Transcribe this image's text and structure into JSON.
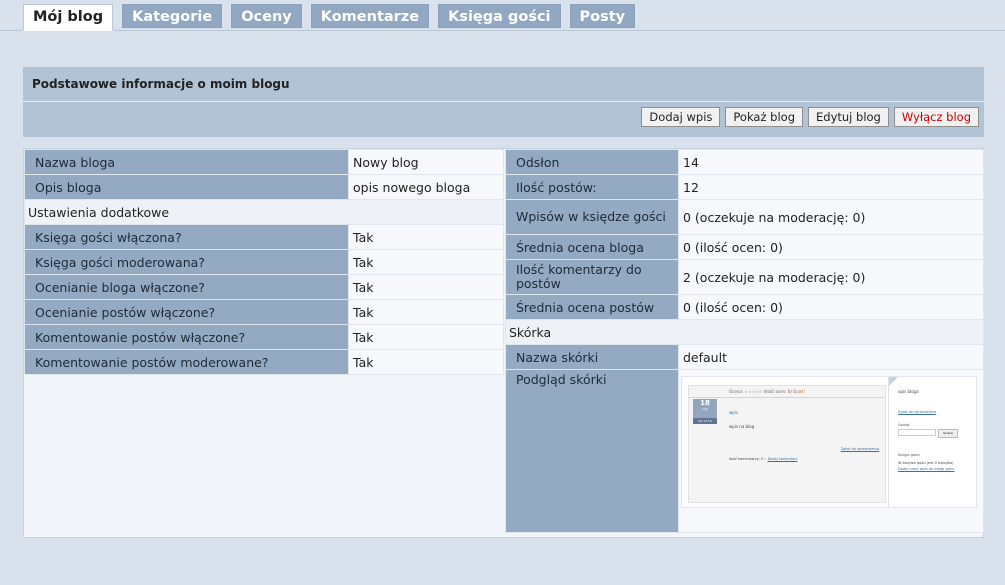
{
  "tabs": [
    {
      "label": "Mój blog",
      "active": true
    },
    {
      "label": "Kategorie",
      "active": false
    },
    {
      "label": "Oceny",
      "active": false
    },
    {
      "label": "Komentarze",
      "active": false
    },
    {
      "label": "Księga gości",
      "active": false
    },
    {
      "label": "Posty",
      "active": false
    }
  ],
  "panel": {
    "title": "Podstawowe informacje o moim blogu",
    "buttons": {
      "add_post": "Dodaj wpis",
      "show_blog": "Pokaż blog",
      "edit_blog": "Edytuj blog",
      "disable_blog": "Wyłącz blog"
    }
  },
  "left": {
    "name_label": "Nazwa bloga",
    "name_value": "Nowy blog",
    "desc_label": "Opis bloga",
    "desc_value": "opis nowego bloga",
    "section_label": "Ustawienia dodatkowe",
    "settings": [
      {
        "label": "Księga gości włączona?",
        "value": "Tak"
      },
      {
        "label": "Księga gości moderowana?",
        "value": "Tak"
      },
      {
        "label": "Ocenianie bloga włączone?",
        "value": "Tak"
      },
      {
        "label": "Ocenianie postów włączone?",
        "value": "Tak"
      },
      {
        "label": "Komentowanie postów włączone?",
        "value": "Tak"
      },
      {
        "label": "Komentowanie postów moderowane?",
        "value": "Tak"
      }
    ]
  },
  "right": {
    "stats": [
      {
        "label": "Odsłon",
        "value": "14"
      },
      {
        "label": "Ilość postów:",
        "value": "12"
      },
      {
        "label": "Wpisów w księdze gości",
        "value": "0 (oczekuje na moderację: 0)"
      },
      {
        "label": "Średnia ocena bloga",
        "value": "0 (ilość ocen: 0)"
      },
      {
        "label": "Ilość komentarzy do postów",
        "value": "2 (oczekuje na moderację: 0)"
      },
      {
        "label": "Średnia ocena postów",
        "value": "0 (ilość ocen: 0)"
      }
    ],
    "skin_section": "Skórka",
    "skin_name_label": "Nazwa skórki",
    "skin_name_value": "default",
    "skin_preview_label": "Podgląd skórki"
  },
  "preview": {
    "rating_text": "Ocena: ☆☆☆☆☆ (Ilość ocen: 0)",
    "rating_link": "Oceń!",
    "date_day": "18",
    "date_month": "luty",
    "date_time": "00:17:16",
    "post_title": "wpis",
    "post_body": "wpis na blog",
    "report_link": "Zgłoś do sprawdzenia",
    "comments_text": "Ilość komentarzy: 0 ::",
    "comments_link": "Dodaj komentarz",
    "side_desc": "opis bloga",
    "side_report": "Zgłoś do sprawdzenia",
    "search_label": "Szukaj:",
    "search_button": "Szukaj",
    "gb_title": "Księga gości",
    "gb_text": "W księdze gości jest 0 wpis(ów)",
    "gb_link": "Dodaj nowy wpis do księgi gości"
  },
  "colors": {
    "page_bg": "#d9e2ec",
    "tab_bg": "#92a7c1",
    "panel_bg": "#b2c3d6",
    "label_cell": "#94a9c2",
    "danger_text": "#cc0000"
  }
}
